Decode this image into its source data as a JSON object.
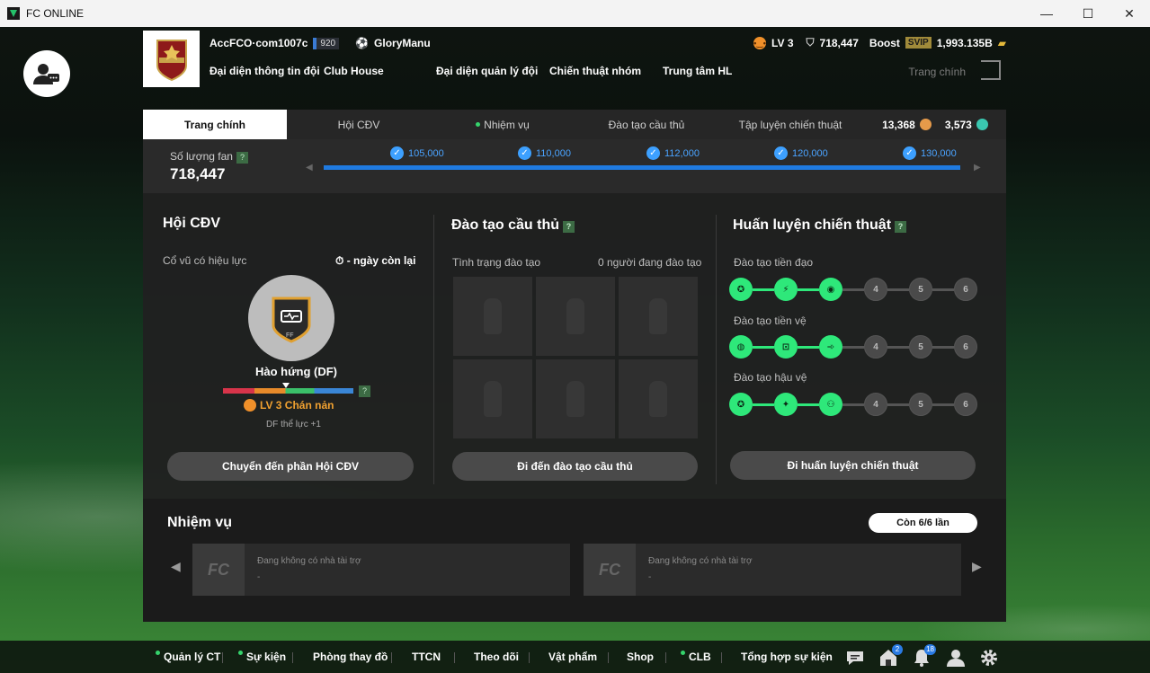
{
  "window": {
    "title": "FC ONLINE",
    "minimize": "—",
    "maximize": "☐",
    "close": "✕"
  },
  "club": {
    "account": "AccFCO·com1007c",
    "level_badge": "920",
    "manager": "GloryManu"
  },
  "top_nav": [
    "Đại diện thông tin đội",
    "Club House",
    "Đại diện quản lý đội",
    "Chiến thuật nhóm",
    "Trung tâm HL"
  ],
  "top_right": {
    "mood_level": "LV 3",
    "fans": "718,447",
    "boost_label": "Boost",
    "vip": "SVIP",
    "currency": "1,993.135B",
    "home_label": "Trang chính"
  },
  "tabs": [
    {
      "label": "Trang chính",
      "active": true
    },
    {
      "label": "Hội CĐV"
    },
    {
      "label": "Nhiệm vụ",
      "dot": true
    },
    {
      "label": "Đào tạo cầu thủ"
    },
    {
      "label": "Tập luyện chiến thuật"
    }
  ],
  "tab_stats": {
    "coins": "13,368",
    "points": "3,573"
  },
  "fans": {
    "label": "Số lượng fan",
    "help": "?",
    "value": "718,447",
    "milestones": [
      "105,000",
      "110,000",
      "112,000",
      "120,000",
      "130,000"
    ]
  },
  "club_fans": {
    "title": "Hội CĐV",
    "effect_label": "Cổ vũ có hiệu lực",
    "days_left": "- ngày còn lại",
    "mood_name": "Hào hứng (DF)",
    "mood_level": "LV 3 Chán nản",
    "bonus": "DF thể lực +1",
    "badge_sub": "FF",
    "button": "Chuyển đến phần Hội CĐV",
    "mood_marker": 0.48
  },
  "training": {
    "title": "Đào tạo cầu thủ",
    "status_label": "Tình trạng đào tạo",
    "count_label": "0 người đang đào tạo",
    "button": "Đi đến đào tạo cầu thủ"
  },
  "tactics": {
    "title": "Huấn luyện chiến thuật",
    "rows": [
      {
        "label": "Đào tạo tiền đạo",
        "nodes": [
          "✪",
          "⚡",
          "◉",
          "4",
          "5",
          "6"
        ],
        "done": 3
      },
      {
        "label": "Đào tạo tiền vệ",
        "nodes": [
          "◍",
          "⊡",
          "➾",
          "4",
          "5",
          "6"
        ],
        "done": 3
      },
      {
        "label": "Đào tạo hậu vệ",
        "nodes": [
          "✪",
          "✦",
          "⚇",
          "4",
          "5",
          "6"
        ],
        "done": 3
      }
    ],
    "button": "Đi huấn luyện chiến thuật"
  },
  "missions": {
    "title": "Nhiệm vụ",
    "remaining": "Còn 6/6 lần",
    "sponsors": [
      {
        "text": "Đang không có nhà tài trợ",
        "sub": "-",
        "logo": "FC"
      },
      {
        "text": "Đang không có nhà tài trợ",
        "sub": "-",
        "logo": "FC"
      }
    ]
  },
  "bottom_nav": [
    {
      "label": "Quản lý CT",
      "dot": true
    },
    {
      "label": "Sự kiện",
      "dot": true
    },
    {
      "label": "Phòng thay đồ"
    },
    {
      "label": "TTCN"
    },
    {
      "label": "Theo dõi"
    },
    {
      "label": "Vật phẩm"
    },
    {
      "label": "Shop"
    },
    {
      "label": "CLB",
      "dot": true
    },
    {
      "label": "Tổng hợp sự kiện"
    }
  ],
  "bottom_badges": {
    "home": "2",
    "bell": "18"
  },
  "colors": {
    "accent_green": "#2ee87a",
    "progress_blue": "#1f7ae0",
    "mood_orange": "#f0a030"
  }
}
